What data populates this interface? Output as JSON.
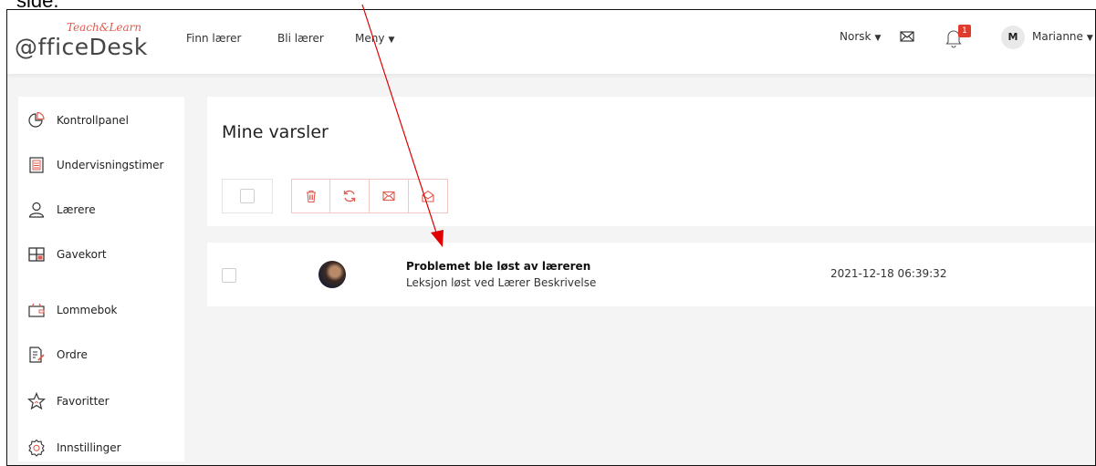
{
  "caption": "side.",
  "logo": {
    "main": "@fficeDesk",
    "sub": "Teach&Learn"
  },
  "navbar": {
    "links": [
      "Finn lærer",
      "Bli lærer",
      "Meny"
    ],
    "language": "Norsk",
    "notification_count": "1",
    "user_initial": "M",
    "user_name": "Marianne"
  },
  "sidebar": {
    "items": [
      {
        "label": "Kontrollpanel",
        "icon": "pie-chart-icon"
      },
      {
        "label": "Undervisningstimer",
        "icon": "document-list-icon"
      },
      {
        "label": "Lærere",
        "icon": "user-icon"
      },
      {
        "label": "Gavekort",
        "icon": "gift-card-icon"
      },
      {
        "label": "Lommebok",
        "icon": "wallet-icon"
      },
      {
        "label": "Ordre",
        "icon": "order-edit-icon"
      },
      {
        "label": "Favoritter",
        "icon": "star-icon"
      },
      {
        "label": "Innstillinger",
        "icon": "gear-icon"
      }
    ]
  },
  "main": {
    "title": "Mine varsler",
    "toolbar": [
      "trash-icon",
      "refresh-icon",
      "mail-icon",
      "open-mail-icon"
    ],
    "notifications": [
      {
        "title": "Problemet ble løst av læreren",
        "subtitle": "Leksjon løst ved Lærer Beskrivelse",
        "date": "2021-12-18 06:39:32"
      }
    ]
  },
  "colors": {
    "accent": "#e05a4e",
    "badge": "#e03b2f",
    "background": "#f4f4f4",
    "arrow": "#e00000"
  }
}
